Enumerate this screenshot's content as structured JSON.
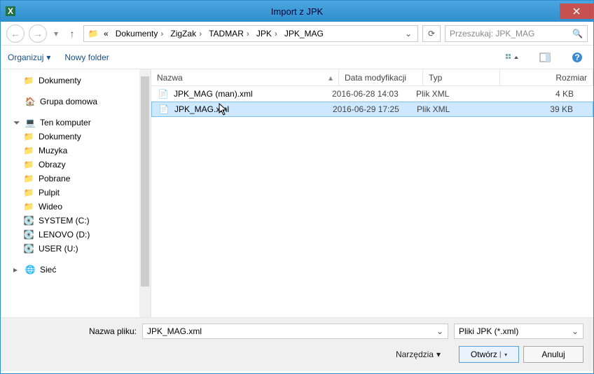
{
  "titlebar": {
    "title": "Import z JPK"
  },
  "breadcrumbs": {
    "prefix": "«",
    "items": [
      "Dokumenty",
      "ZigZak",
      "TADMAR",
      "JPK",
      "JPK_MAG"
    ]
  },
  "search": {
    "placeholder": "Przeszukaj: JPK_MAG"
  },
  "toolbar": {
    "organize": "Organizuj",
    "newfolder": "Nowy folder"
  },
  "tree": {
    "top": [
      {
        "icon": "📁",
        "label": "Dokumenty",
        "indent": true
      }
    ],
    "groups": [
      {
        "icon": "🏠",
        "label": "Grupa domowa",
        "exp": ""
      },
      {
        "icon": "💻",
        "label": "Ten komputer",
        "exp": "⏴",
        "children": [
          {
            "icon": "📁",
            "label": "Dokumenty"
          },
          {
            "icon": "📁",
            "label": "Muzyka"
          },
          {
            "icon": "📁",
            "label": "Obrazy"
          },
          {
            "icon": "📁",
            "label": "Pobrane"
          },
          {
            "icon": "📁",
            "label": "Pulpit"
          },
          {
            "icon": "📁",
            "label": "Wideo"
          },
          {
            "icon": "💽",
            "label": "SYSTEM (C:)"
          },
          {
            "icon": "💽",
            "label": "LENOVO (D:)"
          },
          {
            "icon": "💽",
            "label": "USER (U:)"
          }
        ]
      },
      {
        "icon": "🌐",
        "label": "Sieć",
        "exp": "▸"
      }
    ]
  },
  "files": {
    "headers": {
      "name": "Nazwa",
      "date": "Data modyfikacji",
      "type": "Typ",
      "size": "Rozmiar"
    },
    "rows": [
      {
        "name": "JPK_MAG (man).xml",
        "date": "2016-06-28 14:03",
        "type": "Plik XML",
        "size": "4 KB",
        "selected": false
      },
      {
        "name": "JPK_MAG.xml",
        "date": "2016-06-29 17:25",
        "type": "Plik XML",
        "size": "39 KB",
        "selected": true
      }
    ]
  },
  "footer": {
    "filename_label": "Nazwa pliku:",
    "filename_value": "JPK_MAG.xml",
    "filetype": "Pliki JPK (*.xml)",
    "tools": "Narzędzia",
    "open": "Otwórz",
    "cancel": "Anuluj"
  }
}
